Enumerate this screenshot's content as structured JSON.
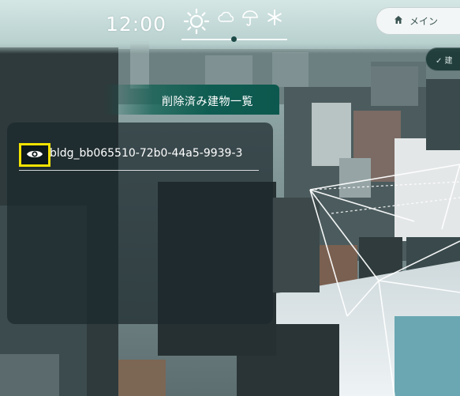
{
  "header": {
    "time": "12:00",
    "weather_icons": [
      "sun-icon",
      "cloud-icon",
      "umbrella-icon",
      "snow-icon"
    ],
    "menu_label": "メイン",
    "menu_icon": "home-icon",
    "side_chip_icon": "check-icon",
    "side_chip_label": "✓ 建"
  },
  "deleted_panel": {
    "title": "削除済み建物一覧",
    "items": [
      {
        "label": "bldg_bb065510-72b0-44a5-9939-3",
        "icon": "eye-icon"
      }
    ]
  },
  "colors": {
    "accent": "#0f5d52",
    "highlight": "#f2e200",
    "topbar": "#d6e8e6"
  }
}
